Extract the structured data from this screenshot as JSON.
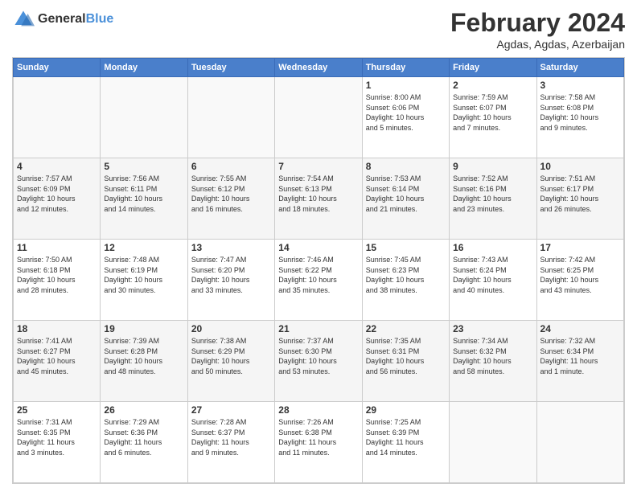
{
  "logo": {
    "text_general": "General",
    "text_blue": "Blue"
  },
  "header": {
    "title": "February 2024",
    "subtitle": "Agdas, Agdas, Azerbaijan"
  },
  "weekdays": [
    "Sunday",
    "Monday",
    "Tuesday",
    "Wednesday",
    "Thursday",
    "Friday",
    "Saturday"
  ],
  "weeks": [
    [
      {
        "day": "",
        "info": ""
      },
      {
        "day": "",
        "info": ""
      },
      {
        "day": "",
        "info": ""
      },
      {
        "day": "",
        "info": ""
      },
      {
        "day": "1",
        "info": "Sunrise: 8:00 AM\nSunset: 6:06 PM\nDaylight: 10 hours\nand 5 minutes."
      },
      {
        "day": "2",
        "info": "Sunrise: 7:59 AM\nSunset: 6:07 PM\nDaylight: 10 hours\nand 7 minutes."
      },
      {
        "day": "3",
        "info": "Sunrise: 7:58 AM\nSunset: 6:08 PM\nDaylight: 10 hours\nand 9 minutes."
      }
    ],
    [
      {
        "day": "4",
        "info": "Sunrise: 7:57 AM\nSunset: 6:09 PM\nDaylight: 10 hours\nand 12 minutes."
      },
      {
        "day": "5",
        "info": "Sunrise: 7:56 AM\nSunset: 6:11 PM\nDaylight: 10 hours\nand 14 minutes."
      },
      {
        "day": "6",
        "info": "Sunrise: 7:55 AM\nSunset: 6:12 PM\nDaylight: 10 hours\nand 16 minutes."
      },
      {
        "day": "7",
        "info": "Sunrise: 7:54 AM\nSunset: 6:13 PM\nDaylight: 10 hours\nand 18 minutes."
      },
      {
        "day": "8",
        "info": "Sunrise: 7:53 AM\nSunset: 6:14 PM\nDaylight: 10 hours\nand 21 minutes."
      },
      {
        "day": "9",
        "info": "Sunrise: 7:52 AM\nSunset: 6:16 PM\nDaylight: 10 hours\nand 23 minutes."
      },
      {
        "day": "10",
        "info": "Sunrise: 7:51 AM\nSunset: 6:17 PM\nDaylight: 10 hours\nand 26 minutes."
      }
    ],
    [
      {
        "day": "11",
        "info": "Sunrise: 7:50 AM\nSunset: 6:18 PM\nDaylight: 10 hours\nand 28 minutes."
      },
      {
        "day": "12",
        "info": "Sunrise: 7:48 AM\nSunset: 6:19 PM\nDaylight: 10 hours\nand 30 minutes."
      },
      {
        "day": "13",
        "info": "Sunrise: 7:47 AM\nSunset: 6:20 PM\nDaylight: 10 hours\nand 33 minutes."
      },
      {
        "day": "14",
        "info": "Sunrise: 7:46 AM\nSunset: 6:22 PM\nDaylight: 10 hours\nand 35 minutes."
      },
      {
        "day": "15",
        "info": "Sunrise: 7:45 AM\nSunset: 6:23 PM\nDaylight: 10 hours\nand 38 minutes."
      },
      {
        "day": "16",
        "info": "Sunrise: 7:43 AM\nSunset: 6:24 PM\nDaylight: 10 hours\nand 40 minutes."
      },
      {
        "day": "17",
        "info": "Sunrise: 7:42 AM\nSunset: 6:25 PM\nDaylight: 10 hours\nand 43 minutes."
      }
    ],
    [
      {
        "day": "18",
        "info": "Sunrise: 7:41 AM\nSunset: 6:27 PM\nDaylight: 10 hours\nand 45 minutes."
      },
      {
        "day": "19",
        "info": "Sunrise: 7:39 AM\nSunset: 6:28 PM\nDaylight: 10 hours\nand 48 minutes."
      },
      {
        "day": "20",
        "info": "Sunrise: 7:38 AM\nSunset: 6:29 PM\nDaylight: 10 hours\nand 50 minutes."
      },
      {
        "day": "21",
        "info": "Sunrise: 7:37 AM\nSunset: 6:30 PM\nDaylight: 10 hours\nand 53 minutes."
      },
      {
        "day": "22",
        "info": "Sunrise: 7:35 AM\nSunset: 6:31 PM\nDaylight: 10 hours\nand 56 minutes."
      },
      {
        "day": "23",
        "info": "Sunrise: 7:34 AM\nSunset: 6:32 PM\nDaylight: 10 hours\nand 58 minutes."
      },
      {
        "day": "24",
        "info": "Sunrise: 7:32 AM\nSunset: 6:34 PM\nDaylight: 11 hours\nand 1 minute."
      }
    ],
    [
      {
        "day": "25",
        "info": "Sunrise: 7:31 AM\nSunset: 6:35 PM\nDaylight: 11 hours\nand 3 minutes."
      },
      {
        "day": "26",
        "info": "Sunrise: 7:29 AM\nSunset: 6:36 PM\nDaylight: 11 hours\nand 6 minutes."
      },
      {
        "day": "27",
        "info": "Sunrise: 7:28 AM\nSunset: 6:37 PM\nDaylight: 11 hours\nand 9 minutes."
      },
      {
        "day": "28",
        "info": "Sunrise: 7:26 AM\nSunset: 6:38 PM\nDaylight: 11 hours\nand 11 minutes."
      },
      {
        "day": "29",
        "info": "Sunrise: 7:25 AM\nSunset: 6:39 PM\nDaylight: 11 hours\nand 14 minutes."
      },
      {
        "day": "",
        "info": ""
      },
      {
        "day": "",
        "info": ""
      }
    ]
  ]
}
